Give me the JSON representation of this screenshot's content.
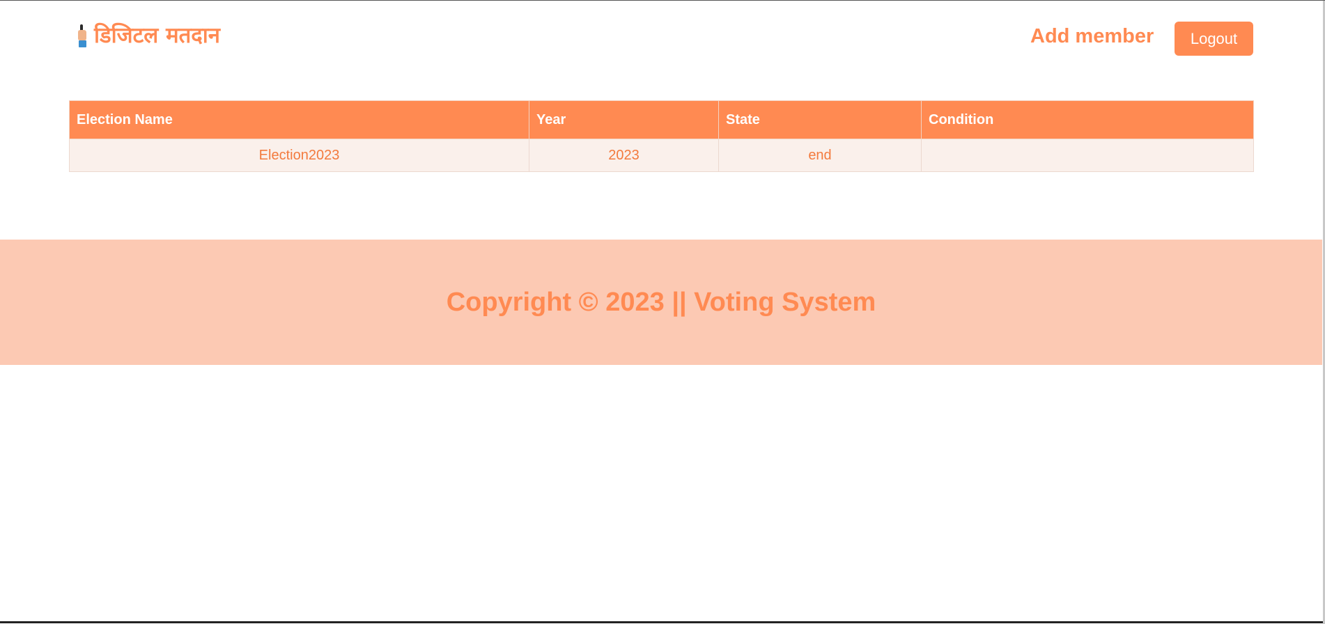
{
  "header": {
    "brand_text": "डिजिटल मतदान",
    "brand_icon": "voting-finger-icon",
    "add_member_label": "Add member",
    "logout_label": "Logout"
  },
  "table": {
    "columns": [
      "Election Name",
      "Year",
      "State",
      "Condition"
    ],
    "rows": [
      {
        "election_name": "Election2023",
        "year": "2023",
        "state": "end",
        "condition": ""
      }
    ]
  },
  "footer": {
    "copyright": "Copyright © 2023 || Voting System"
  },
  "colors": {
    "accent": "#ff8a52",
    "footer_bg": "#fcc9b3",
    "row_bg": "#faf0eb",
    "cell_text": "#f37a3d"
  }
}
